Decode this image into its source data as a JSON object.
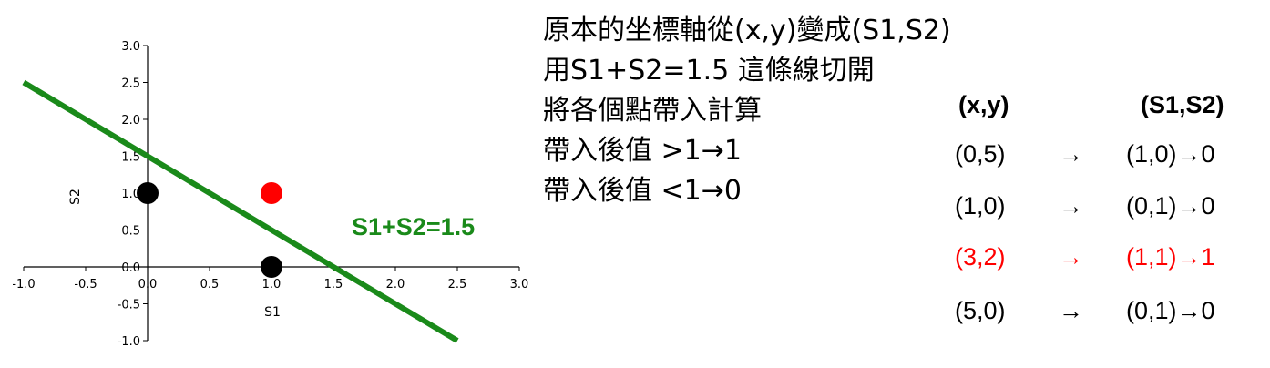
{
  "chart_data": {
    "type": "scatter",
    "xlabel": "S1",
    "ylabel": "S2",
    "xlim": [
      -1.0,
      3.0
    ],
    "ylim": [
      -1.0,
      3.0
    ],
    "xticks": [
      "-1.0",
      "-0.5",
      "0.0",
      "0.5",
      "1.0",
      "1.5",
      "2.0",
      "2.5",
      "3.0"
    ],
    "yticks": [
      "-1.0",
      "-0.5",
      "0.0",
      "0.5",
      "1.0",
      "1.5",
      "2.0",
      "2.5",
      "3.0"
    ],
    "points": [
      {
        "x": 0.0,
        "y": 1.0,
        "color": "#000000"
      },
      {
        "x": 1.0,
        "y": 0.0,
        "color": "#000000"
      },
      {
        "x": 1.0,
        "y": 1.0,
        "color": "#ff0000"
      }
    ],
    "line": {
      "equation": "S1+S2=1.5",
      "label": "S1+S2=1.5",
      "color": "#1a8a1a",
      "x_range": [
        -1.0,
        2.5
      ]
    },
    "axes_through_origin": true,
    "grid": false
  },
  "notes": [
    "原本的坐標軸從(x,y)變成(S1,S2)",
    "用S1+S2=1.5 這條線切開",
    "將各個點帶入計算",
    "帶入後值 >1→1",
    "帶入後值 <1→0"
  ],
  "mapping": {
    "header_left": "(x,y)",
    "header_right": "(S1,S2)",
    "arrow": "→",
    "rows": [
      {
        "input": "(0,5)",
        "output": "(1,0)→0",
        "color": "#000000"
      },
      {
        "input": "(1,0)",
        "output": "(0,1)→0",
        "color": "#000000"
      },
      {
        "input": "(3,2)",
        "output": "(1,1)→1",
        "color": "#ff0000"
      },
      {
        "input": "(5,0)",
        "output": "(0,1)→0",
        "color": "#000000"
      }
    ]
  }
}
